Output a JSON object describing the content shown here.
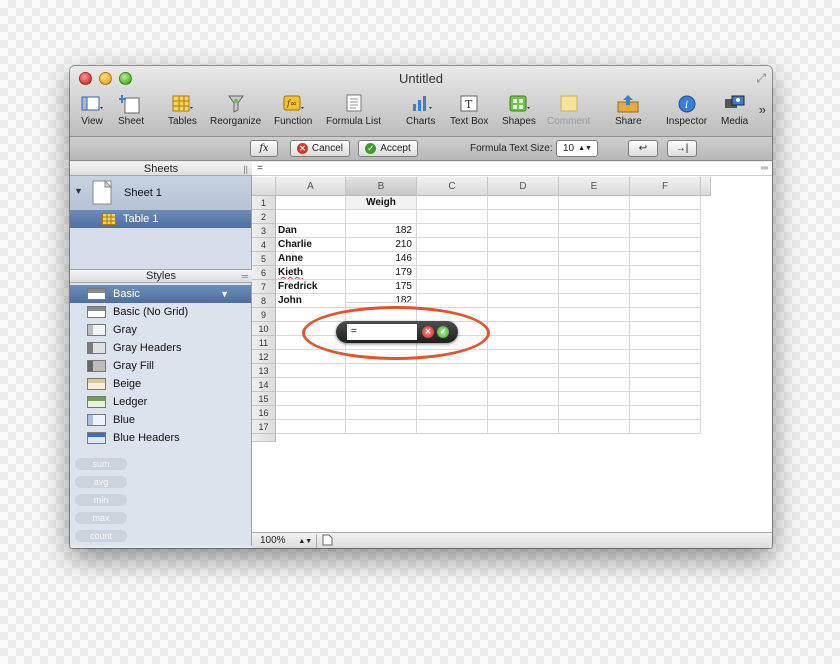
{
  "window": {
    "title": "Untitled"
  },
  "toolbar": {
    "items": [
      {
        "label": "View",
        "icon": "view-icon"
      },
      {
        "label": "Sheet",
        "icon": "sheet-icon"
      },
      {
        "label": "Tables",
        "icon": "tables-icon"
      },
      {
        "label": "Reorganize",
        "icon": "reorganize-icon"
      },
      {
        "label": "Function",
        "icon": "function-icon"
      },
      {
        "label": "Formula List",
        "icon": "formula-list-icon"
      },
      {
        "label": "Charts",
        "icon": "charts-icon"
      },
      {
        "label": "Text Box",
        "icon": "text-box-icon"
      },
      {
        "label": "Shapes",
        "icon": "shapes-icon"
      },
      {
        "label": "Comment",
        "icon": "comment-icon"
      },
      {
        "label": "Share",
        "icon": "share-icon"
      },
      {
        "label": "Inspector",
        "icon": "inspector-icon"
      },
      {
        "label": "Media",
        "icon": "media-icon"
      }
    ],
    "overflow": "»"
  },
  "formula_bar": {
    "fx_label": "fx",
    "cancel_label": "Cancel",
    "accept_label": "Accept",
    "text_size_label": "Formula Text Size:",
    "text_size_value": "10",
    "left_arrow": "↩",
    "tab_arrow": "→|",
    "formula_text": "="
  },
  "sheets": {
    "header": "Sheets",
    "sheet_name": "Sheet 1",
    "table_name": "Table 1"
  },
  "styles": {
    "header": "Styles",
    "items": [
      "Basic",
      "Basic (No Grid)",
      "Gray",
      "Gray Headers",
      "Gray Fill",
      "Beige",
      "Ledger",
      "Blue",
      "Blue Headers"
    ],
    "selected": "Basic"
  },
  "quick_calc": [
    "sum",
    "avg",
    "min",
    "max",
    "count"
  ],
  "grid": {
    "columns": [
      "A",
      "B",
      "C",
      "D",
      "E",
      "F"
    ],
    "rows": [
      "1",
      "2",
      "3",
      "4",
      "5",
      "6",
      "7",
      "8",
      "9",
      "10",
      "11",
      "12",
      "13",
      "14",
      "15",
      "16",
      "17"
    ],
    "header_cell": "Weigh",
    "data": [
      {
        "name": "Dan",
        "value": "182"
      },
      {
        "name": "Charlie",
        "value": "210"
      },
      {
        "name": "Anne",
        "value": "146"
      },
      {
        "name": "Kieth",
        "value": "179"
      },
      {
        "name": "Fredrick",
        "value": "175"
      },
      {
        "name": "John",
        "value": "182"
      }
    ]
  },
  "hud": {
    "value": "="
  },
  "status": {
    "zoom": "100%"
  },
  "colors": {
    "accent": "#e2542c",
    "selection": "#4d6f9f"
  }
}
